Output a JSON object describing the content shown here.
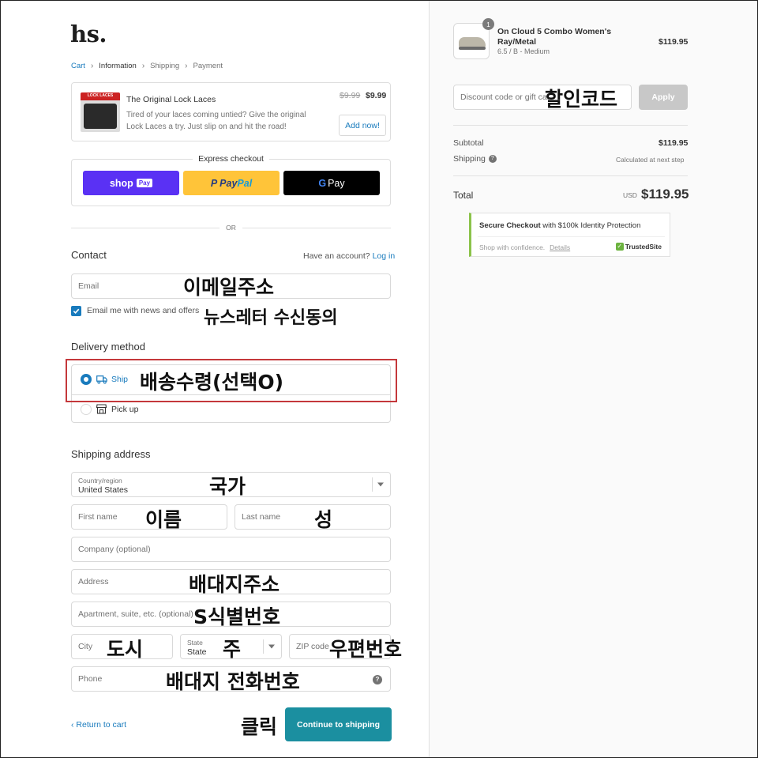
{
  "brand": {
    "logo": "hs."
  },
  "breadcrumb": {
    "items": [
      "Cart",
      "Information",
      "Shipping",
      "Payment"
    ]
  },
  "upsell": {
    "image_label": "LOCK LACES",
    "title": "The Original Lock Laces",
    "description": "Tired of your laces coming untied? Give the original Lock Laces a try. Just slip on and hit the road!",
    "old_price": "$9.99",
    "new_price": "$9.99",
    "add_label": "Add now!"
  },
  "express": {
    "label": "Express checkout",
    "shop_pay": "shop",
    "shop_pay_tag": "Pay",
    "paypal_a": "Pay",
    "paypal_b": "Pal",
    "gpay_g": "G",
    "gpay": "Pay"
  },
  "divider": "OR",
  "contact": {
    "title": "Contact",
    "have_account": "Have an account?",
    "login": "Log in",
    "email_placeholder": "Email",
    "newsletter_label": "Email me with news and offers"
  },
  "delivery": {
    "title": "Delivery method",
    "options": [
      {
        "label": "Ship",
        "selected": true,
        "icon": "truck-icon"
      },
      {
        "label": "Pick up",
        "selected": false,
        "icon": "store-icon"
      }
    ]
  },
  "shipping": {
    "title": "Shipping address",
    "country_label": "Country/region",
    "country_value": "United States",
    "first_name": "First name",
    "last_name": "Last name",
    "company": "Company (optional)",
    "address": "Address",
    "apartment": "Apartment, suite, etc. (optional)",
    "city": "City",
    "state_label": "State",
    "state_value": "State",
    "zip": "ZIP code",
    "phone": "Phone"
  },
  "footer": {
    "return": "Return to cart",
    "continue": "Continue to shipping"
  },
  "annotations": {
    "discount": "할인코드",
    "email": "이메일주소",
    "newsletter": "뉴스레터 수신동의",
    "ship": "배송수령(선택O)",
    "country": "국가",
    "first_name": "이름",
    "last_name": "성",
    "address": "배대지주소",
    "apartment": "S식별번호",
    "city": "도시",
    "state": "주",
    "zip": "우편번호",
    "phone": "배대지 전화번호",
    "click": "클릭"
  },
  "summary": {
    "qty": "1",
    "product_name": "On Cloud 5 Combo Women's Ray/Metal",
    "variant": "6.5 / B - Medium",
    "price": "$119.95",
    "discount_placeholder": "Discount code or gift card",
    "apply": "Apply",
    "subtotal_label": "Subtotal",
    "subtotal_value": "$119.95",
    "shipping_label": "Shipping",
    "shipping_value": "Calculated at next step",
    "total_label": "Total",
    "currency": "USD",
    "total_value": "$119.95"
  },
  "trust": {
    "title_bold": "Secure Checkout",
    "title_rest": " with $100k Identity Protection",
    "confidence": "Shop with confidence.",
    "details": "Details",
    "badge": "TrustedSite"
  },
  "colors": {
    "accent": "#197bbd",
    "button": "#1b8fa0",
    "highlight": "#c4383b"
  }
}
